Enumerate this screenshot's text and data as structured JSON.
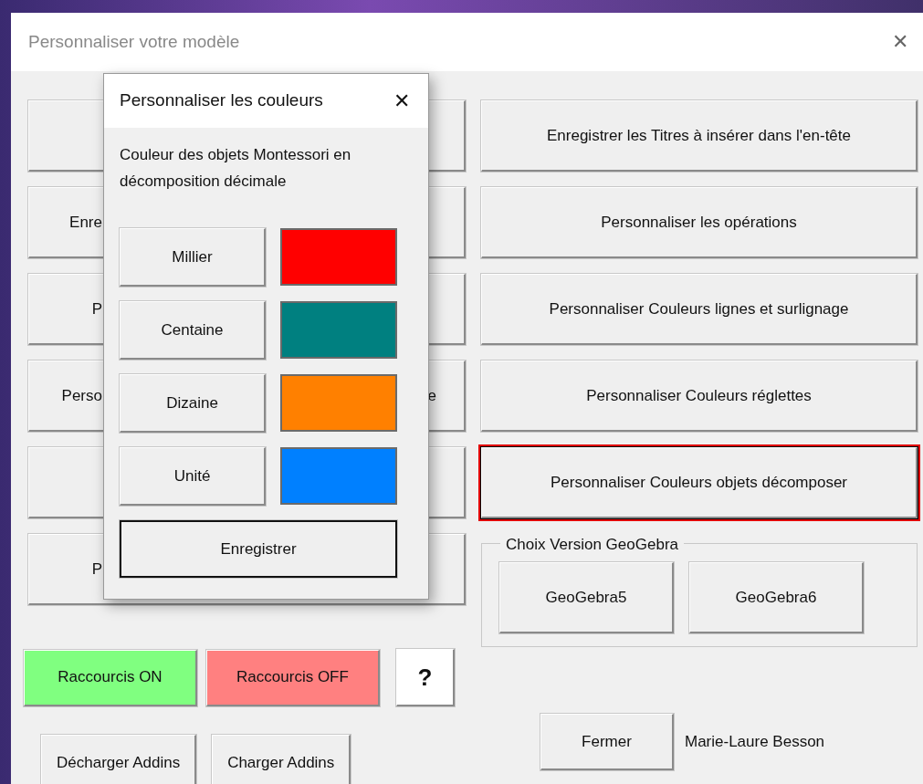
{
  "window": {
    "title": "Personnaliser votre modèle",
    "close": "✕"
  },
  "left_buttons": [
    {
      "kind": "covered"
    },
    {
      "kind": "partial",
      "text_start": "Enre"
    },
    {
      "kind": "partial",
      "text_start": "P"
    },
    {
      "kind": "partial",
      "text_start": "Perso",
      "text_end": "e"
    },
    {
      "kind": "covered"
    },
    {
      "kind": "partial",
      "text_start": "P"
    }
  ],
  "right_buttons": [
    {
      "label": "Enregistrer les Titres à insérer dans l'en-tête",
      "selected": false
    },
    {
      "label": "Personnaliser les opérations",
      "selected": false
    },
    {
      "label": "Personnaliser Couleurs lignes et surlignage",
      "selected": false
    },
    {
      "label": "Personnaliser Couleurs réglettes",
      "selected": false
    },
    {
      "label": "Personnaliser Couleurs objets décomposer",
      "selected": true
    }
  ],
  "geogebra_group": {
    "title": "Choix Version GeoGebra",
    "buttons": [
      "GeoGebra5",
      "GeoGebra6"
    ]
  },
  "shortcut_buttons": [
    {
      "label": "Raccourcis ON",
      "color": "#80ff80"
    },
    {
      "label": "Raccourcis OFF",
      "color": "#ff8080"
    },
    {
      "label": "?",
      "color": "#ffffff"
    }
  ],
  "bottom_buttons": [
    "Décharger Addins",
    "Charger Addins"
  ],
  "close_button": "Fermer",
  "author": "Marie-Laure Besson",
  "dialog": {
    "title": "Personnaliser les couleurs",
    "close": "✕",
    "description": "Couleur des objets Montessori en décomposition décimale",
    "rows": [
      {
        "label": "Millier",
        "color": "#ff0000"
      },
      {
        "label": "Centaine",
        "color": "#008080"
      },
      {
        "label": "Dizaine",
        "color": "#ff8000"
      },
      {
        "label": "Unité",
        "color": "#0080ff"
      }
    ],
    "save_button": "Enregistrer"
  }
}
